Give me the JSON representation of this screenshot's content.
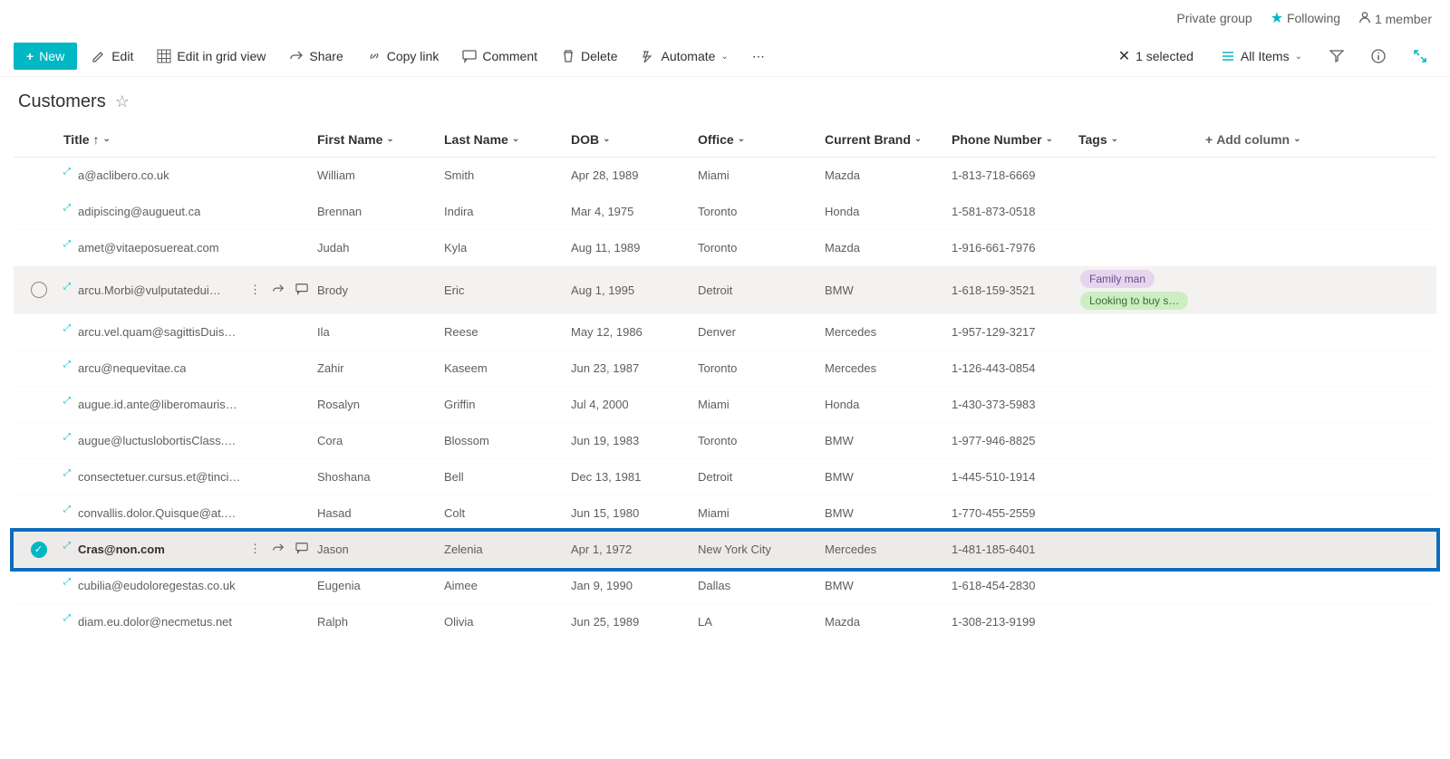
{
  "topbar": {
    "privateGroup": "Private group",
    "following": "Following",
    "members": "1 member"
  },
  "toolbar": {
    "new": "New",
    "edit": "Edit",
    "editGrid": "Edit in grid view",
    "share": "Share",
    "copyLink": "Copy link",
    "comment": "Comment",
    "delete": "Delete",
    "automate": "Automate",
    "selected": "1 selected",
    "allItems": "All Items"
  },
  "list": {
    "title": "Customers"
  },
  "columns": {
    "title": "Title",
    "firstName": "First Name",
    "lastName": "Last Name",
    "dob": "DOB",
    "office": "Office",
    "currentBrand": "Current Brand",
    "phone": "Phone Number",
    "tags": "Tags",
    "addColumn": "Add column"
  },
  "rows": [
    {
      "title": "a@aclibero.co.uk",
      "first": "William",
      "last": "Smith",
      "dob": "Apr 28, 1989",
      "office": "Miami",
      "brand": "Mazda",
      "phone": "1-813-718-6669"
    },
    {
      "title": "adipiscing@augueut.ca",
      "first": "Brennan",
      "last": "Indira",
      "dob": "Mar 4, 1975",
      "office": "Toronto",
      "brand": "Honda",
      "phone": "1-581-873-0518"
    },
    {
      "title": "amet@vitaeposuereat.com",
      "first": "Judah",
      "last": "Kyla",
      "dob": "Aug 11, 1989",
      "office": "Toronto",
      "brand": "Mazda",
      "phone": "1-916-661-7976"
    },
    {
      "title": "arcu.Morbi@vulputatedui…",
      "first": "Brody",
      "last": "Eric",
      "dob": "Aug 1, 1995",
      "office": "Detroit",
      "brand": "BMW",
      "phone": "1-618-159-3521",
      "tags": [
        {
          "text": "Family man",
          "cls": "tag-purple"
        },
        {
          "text": "Looking to buy s…",
          "cls": "tag-green"
        }
      ],
      "hover": true
    },
    {
      "title": "arcu.vel.quam@sagittisDuisgravida.com",
      "first": "Ila",
      "last": "Reese",
      "dob": "May 12, 1986",
      "office": "Denver",
      "brand": "Mercedes",
      "phone": "1-957-129-3217"
    },
    {
      "title": "arcu@nequevitae.ca",
      "first": "Zahir",
      "last": "Kaseem",
      "dob": "Jun 23, 1987",
      "office": "Toronto",
      "brand": "Mercedes",
      "phone": "1-126-443-0854"
    },
    {
      "title": "augue.id.ante@liberomaurisaliquam.co.uk",
      "first": "Rosalyn",
      "last": "Griffin",
      "dob": "Jul 4, 2000",
      "office": "Miami",
      "brand": "Honda",
      "phone": "1-430-373-5983"
    },
    {
      "title": "augue@luctuslobortisClass.co.uk",
      "first": "Cora",
      "last": "Blossom",
      "dob": "Jun 19, 1983",
      "office": "Toronto",
      "brand": "BMW",
      "phone": "1-977-946-8825"
    },
    {
      "title": "consectetuer.cursus.et@tinciduntDonec.co.uk",
      "first": "Shoshana",
      "last": "Bell",
      "dob": "Dec 13, 1981",
      "office": "Detroit",
      "brand": "BMW",
      "phone": "1-445-510-1914"
    },
    {
      "title": "convallis.dolor.Quisque@at.co.uk",
      "first": "Hasad",
      "last": "Colt",
      "dob": "Jun 15, 1980",
      "office": "Miami",
      "brand": "BMW",
      "phone": "1-770-455-2559"
    },
    {
      "title": "Cras@non.com",
      "first": "Jason",
      "last": "Zelenia",
      "dob": "Apr 1, 1972",
      "office": "New York City",
      "brand": "Mercedes",
      "phone": "1-481-185-6401",
      "selected": true
    },
    {
      "title": "cubilia@eudoloregestas.co.uk",
      "first": "Eugenia",
      "last": "Aimee",
      "dob": "Jan 9, 1990",
      "office": "Dallas",
      "brand": "BMW",
      "phone": "1-618-454-2830"
    },
    {
      "title": "diam.eu.dolor@necmetus.net",
      "first": "Ralph",
      "last": "Olivia",
      "dob": "Jun 25, 1989",
      "office": "LA",
      "brand": "Mazda",
      "phone": "1-308-213-9199"
    }
  ]
}
